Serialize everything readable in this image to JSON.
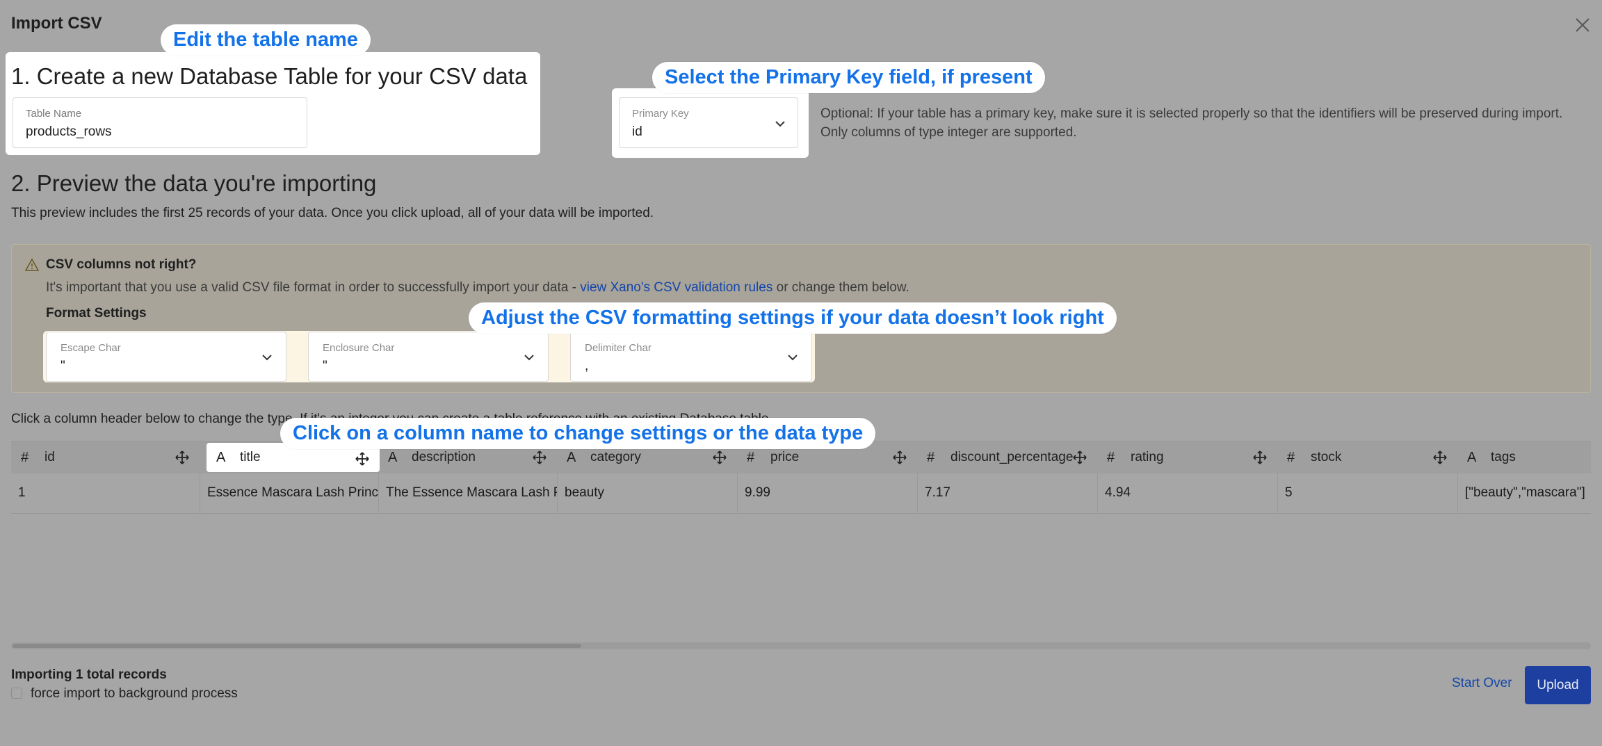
{
  "dialog": {
    "title": "Import CSV",
    "close_icon": "close-icon"
  },
  "callouts": {
    "table_name": "Edit the table name",
    "primary_key": "Select the Primary Key field, if present",
    "csv_format": "Adjust the CSV formatting settings if your data doesn’t look right",
    "column_name": "Click on a column name to change settings or the data type"
  },
  "step1": {
    "heading": "1. Create a new Database Table for your CSV data",
    "table_name_label": "Table Name",
    "table_name_value": "products_rows",
    "primary_key_label": "Primary Key",
    "primary_key_value": "id",
    "optional_line1": "Optional: If your table has a primary key, make sure it is selected properly so that the identifiers will be preserved during import.",
    "optional_line2": "Only columns of type integer are supported."
  },
  "step2": {
    "heading": "2. Preview the data you're importing",
    "description": "This preview includes the first 25 records of your data. Once you click upload, all of your data will be imported."
  },
  "warning": {
    "icon": "warning-triangle-icon",
    "title": "CSV columns not right?",
    "text_before": "It's important that you use a valid CSV file format in order to successfully import your data - ",
    "link": "view Xano's CSV validation rules",
    "text_after": " or change them below.",
    "format_heading": "Format Settings",
    "escape_label": "Escape Char",
    "escape_value": "\"",
    "enclosure_label": "Enclosure Char",
    "enclosure_value": "\"",
    "delimiter_label": "Delimiter Char",
    "delimiter_value": ","
  },
  "table": {
    "hint": "Click a column header below to change the type. If it's an integer you can create a table reference with an existing Database table.",
    "columns": [
      {
        "type_icon": "#",
        "name": "id"
      },
      {
        "type_icon": "A",
        "name": "title"
      },
      {
        "type_icon": "A",
        "name": "description"
      },
      {
        "type_icon": "A",
        "name": "category"
      },
      {
        "type_icon": "#",
        "name": "price"
      },
      {
        "type_icon": "#",
        "name": "discount_percentage"
      },
      {
        "type_icon": "#",
        "name": "rating"
      },
      {
        "type_icon": "#",
        "name": "stock"
      },
      {
        "type_icon": "A",
        "name": "tags"
      }
    ],
    "rows": [
      [
        "1",
        "Essence Mascara Lash Princess",
        "The Essence Mascara Lash Princess",
        "beauty",
        "9.99",
        "7.17",
        "4.94",
        "5",
        "[\"beauty\",\"mascara\"]"
      ]
    ]
  },
  "footer": {
    "records": "Importing 1 total records",
    "checkbox_label": "force import to background process",
    "start_over": "Start Over",
    "upload": "Upload"
  },
  "colors": {
    "accent": "#1472e8",
    "button": "#1c3fa0",
    "link": "#1446a8"
  }
}
